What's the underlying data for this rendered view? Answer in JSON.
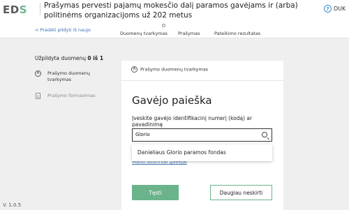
{
  "header": {
    "logo": {
      "part1": "ED",
      "part2": "S"
    },
    "title": "Prašymas pervesti pajamų mokesčio dalį paramos gavėjams ir (arba) politinėms organizacijoms už 202   metus",
    "help_label": "DUK",
    "help_icon": "question-circle-icon"
  },
  "stepbar": {
    "back_link": "< Pradėti pildyti iš naujo",
    "steps": [
      "Duomenų tvarkymas",
      "Prašymas",
      "Pateikimo rezultatas"
    ]
  },
  "sidebar": {
    "filled_prefix": "Užpildyta duomenų",
    "filled_value": "0 iš 1",
    "steps": [
      {
        "marker": "A",
        "label": "Prašymo duomenų tvarkymas"
      },
      {
        "marker": "doc-icon",
        "label": "Prašymo formavimas"
      }
    ]
  },
  "card": {
    "step_marker": "A",
    "step_label": "Prašymo duomenų tvarkymas",
    "heading": "Gavėjo paieška",
    "field_label": "Įveskite gavėjo identifikacinį numerį (kodą) ar pavadinimą",
    "search_value": "Glorio",
    "history_link": "Mano istoriniai gavėjai",
    "suggestion": "Danieliaus Glorio paramos fondas"
  },
  "buttons": {
    "continue": "Tęsti",
    "assign_more": "Daugiau neskirti"
  },
  "version": "V. 1.0.5",
  "colors": {
    "accent": "#6bb38b",
    "link": "#3a6fb5",
    "background": "#efefef"
  }
}
